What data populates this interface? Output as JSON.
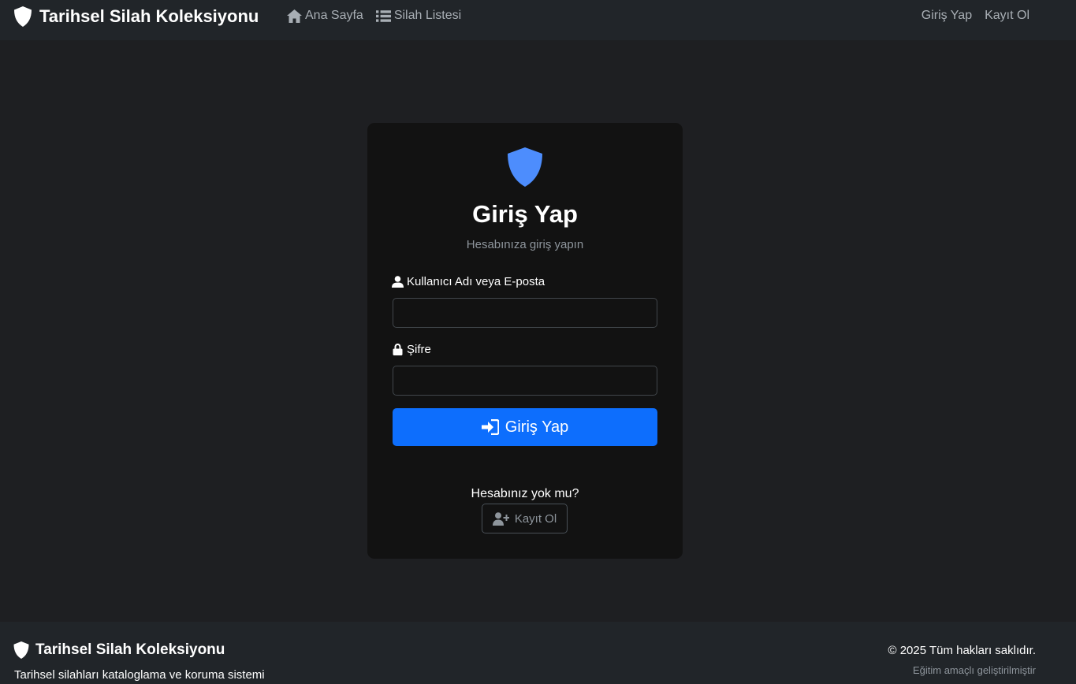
{
  "navbar": {
    "brand": "Tarihsel Silah Koleksiyonu",
    "links": [
      {
        "label": "Ana Sayfa",
        "icon": "home-icon"
      },
      {
        "label": "Silah Listesi",
        "icon": "list-icon"
      }
    ],
    "right": [
      "Giriş Yap",
      "Kayıt Ol"
    ]
  },
  "card": {
    "title": "Giriş Yap",
    "subtitle": "Hesabınıza giriş yapın",
    "username_label": "Kullanıcı Adı veya E-posta",
    "username_value": "",
    "password_label": "Şifre",
    "password_value": "",
    "login_button": "Giriş Yap",
    "no_account": "Hesabınız yok mu?",
    "register_button": "Kayıt Ol"
  },
  "footer": {
    "brand": "Tarihsel Silah Koleksiyonu",
    "description": "Tarihsel silahları kataloglama ve koruma sistemi",
    "copyright": "© 2025 Tüm hakları saklıdır.",
    "note": "Eğitim amaçlı geliştirilmiştir"
  },
  "colors": {
    "accent": "#0d6efd",
    "shield": "#4d8dfd",
    "navbar_bg": "#212529",
    "page_bg": "#1e1f22",
    "card_bg": "#121212"
  }
}
